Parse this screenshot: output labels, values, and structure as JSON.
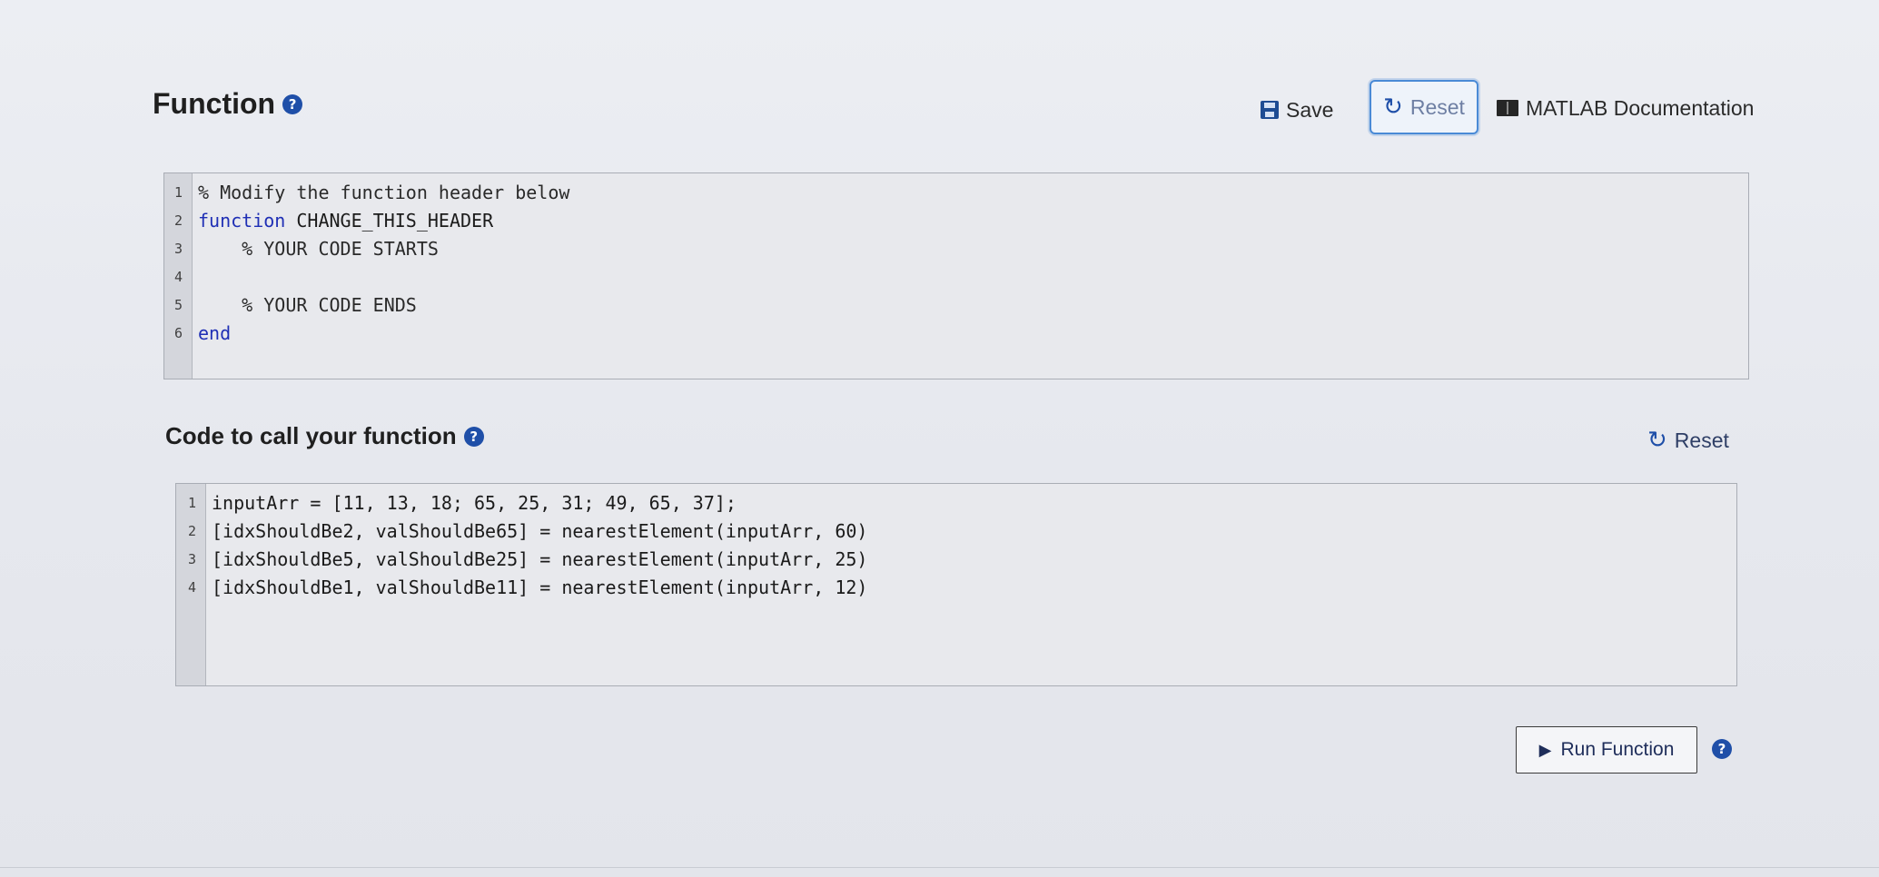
{
  "function_section": {
    "title": "Function",
    "help_glyph": "?",
    "toolbar": {
      "save_label": "Save",
      "reset_label": "Reset",
      "docs_label": "MATLAB Documentation"
    },
    "code_lines": [
      {
        "num": "1",
        "parts": [
          {
            "cls": "cm-dark",
            "text": "% Modify the function header below"
          }
        ]
      },
      {
        "num": "2",
        "parts": [
          {
            "cls": "kw",
            "text": "function"
          },
          {
            "cls": "",
            "text": " CHANGE_THIS_HEADER"
          }
        ]
      },
      {
        "num": "3",
        "parts": [
          {
            "cls": "cm-dark",
            "text": "    % YOUR CODE STARTS"
          }
        ]
      },
      {
        "num": "4",
        "parts": [
          {
            "cls": "",
            "text": ""
          }
        ]
      },
      {
        "num": "5",
        "parts": [
          {
            "cls": "cm-dark",
            "text": "    % YOUR CODE ENDS"
          }
        ]
      },
      {
        "num": "6",
        "parts": [
          {
            "cls": "kw",
            "text": "end"
          }
        ]
      }
    ]
  },
  "call_section": {
    "title": "Code to call your function",
    "help_glyph": "?",
    "reset_label": "Reset",
    "code_lines": [
      {
        "num": "1",
        "text": "inputArr = [11, 13, 18; 65, 25, 31; 49, 65, 37];"
      },
      {
        "num": "2",
        "text": "[idxShouldBe2, valShouldBe65] = nearestElement(inputArr, 60)"
      },
      {
        "num": "3",
        "text": "[idxShouldBe5, valShouldBe25] = nearestElement(inputArr, 25)"
      },
      {
        "num": "4",
        "text": "[idxShouldBe1, valShouldBe11] = nearestElement(inputArr, 12)"
      }
    ]
  },
  "run": {
    "label": "Run Function",
    "help_glyph": "?"
  },
  "icons": {
    "save": "save-icon",
    "reset": "reset-icon",
    "docs": "book-icon",
    "help": "help-icon",
    "play": "play-icon"
  }
}
